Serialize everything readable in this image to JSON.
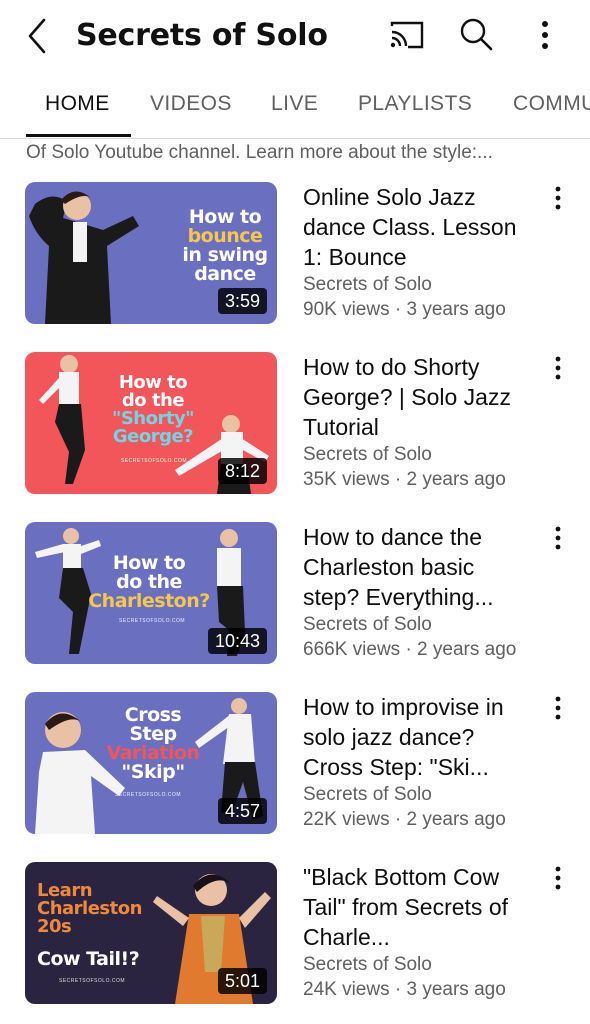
{
  "header": {
    "title": "Secrets of Solo",
    "icons": [
      "back-arrow-icon",
      "cast-icon",
      "search-icon",
      "more-vert-icon"
    ]
  },
  "tabs": [
    {
      "label": "HOME",
      "active": true
    },
    {
      "label": "VIDEOS",
      "active": false
    },
    {
      "label": "LIVE",
      "active": false
    },
    {
      "label": "PLAYLISTS",
      "active": false
    },
    {
      "label": "COMMU",
      "active": false
    }
  ],
  "description": "Of Solo Youtube channel. Learn more about the style:...",
  "videos": [
    {
      "title": "Online Solo Jazz dance Class. Lesson 1: Bounce",
      "channel": "Secrets of Solo",
      "meta": "90K views · 3 years ago",
      "duration": "3:59",
      "thumb_text": [
        "How to",
        "bounce",
        "in swing",
        "dance"
      ],
      "thumb_bg": "#6b6fc0"
    },
    {
      "title": "How to do Shorty George? | Solo Jazz Tutorial",
      "channel": "Secrets of Solo",
      "meta": "35K views · 2 years ago",
      "duration": "8:12",
      "thumb_text": [
        "How to",
        "do the",
        "\"Shorty\"",
        "George?"
      ],
      "thumb_small": "SECRETSOFSOLO.COM",
      "thumb_bg": "#f2555a"
    },
    {
      "title": "How to dance the Charleston basic step? Everything...",
      "channel": "Secrets of Solo",
      "meta": "666K views · 2 years ago",
      "duration": "10:43",
      "thumb_text": [
        "How to",
        "do the",
        "Charleston?"
      ],
      "thumb_small": "SECRETSOFSOLO.COM",
      "thumb_bg": "#6b6fc0"
    },
    {
      "title": "How to improvise in solo jazz dance? Cross Step: \"Ski...",
      "channel": "Secrets of Solo",
      "meta": "22K views · 2 years ago",
      "duration": "4:57",
      "thumb_text": [
        "Cross",
        "Step",
        "Variation",
        "\"Skip\""
      ],
      "thumb_small": "SECRETSOFSOLO.COM",
      "thumb_bg": "#6b6fc0"
    },
    {
      "title": "\"Black Bottom Cow Tail\" from Secrets of Charle...",
      "channel": "Secrets of Solo",
      "meta": "24K views · 3 years ago",
      "duration": "5:01",
      "thumb_text": [
        "Learn",
        "Charleston",
        "20s",
        "Cow Tail!?"
      ],
      "thumb_small": "SECRETSOFSOLO.COM",
      "thumb_bg": "#2a2440"
    }
  ],
  "colors": {
    "text_primary": "#0f0f0f",
    "text_secondary": "#606060",
    "thumb_accent_yellow": "#f5c84a",
    "thumb_accent_cyan": "#6fd6e6",
    "thumb_accent_red": "#f2555a",
    "thumb_accent_orange": "#f08a3a"
  }
}
